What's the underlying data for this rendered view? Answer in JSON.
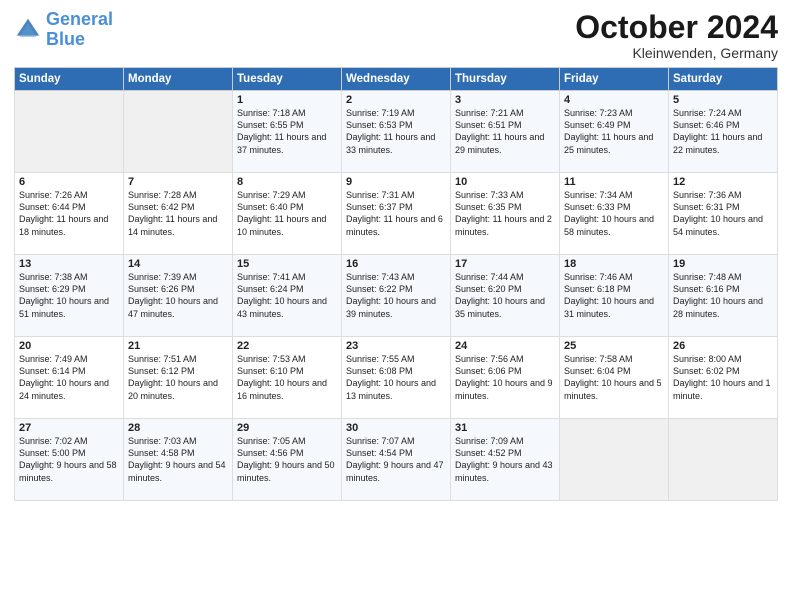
{
  "logo": {
    "line1": "General",
    "line2": "Blue"
  },
  "title": "October 2024",
  "location": "Kleinwenden, Germany",
  "days_header": [
    "Sunday",
    "Monday",
    "Tuesday",
    "Wednesday",
    "Thursday",
    "Friday",
    "Saturday"
  ],
  "weeks": [
    [
      {
        "day": "",
        "info": ""
      },
      {
        "day": "",
        "info": ""
      },
      {
        "day": "1",
        "info": "Sunrise: 7:18 AM\nSunset: 6:55 PM\nDaylight: 11 hours\nand 37 minutes."
      },
      {
        "day": "2",
        "info": "Sunrise: 7:19 AM\nSunset: 6:53 PM\nDaylight: 11 hours\nand 33 minutes."
      },
      {
        "day": "3",
        "info": "Sunrise: 7:21 AM\nSunset: 6:51 PM\nDaylight: 11 hours\nand 29 minutes."
      },
      {
        "day": "4",
        "info": "Sunrise: 7:23 AM\nSunset: 6:49 PM\nDaylight: 11 hours\nand 25 minutes."
      },
      {
        "day": "5",
        "info": "Sunrise: 7:24 AM\nSunset: 6:46 PM\nDaylight: 11 hours\nand 22 minutes."
      }
    ],
    [
      {
        "day": "6",
        "info": "Sunrise: 7:26 AM\nSunset: 6:44 PM\nDaylight: 11 hours\nand 18 minutes."
      },
      {
        "day": "7",
        "info": "Sunrise: 7:28 AM\nSunset: 6:42 PM\nDaylight: 11 hours\nand 14 minutes."
      },
      {
        "day": "8",
        "info": "Sunrise: 7:29 AM\nSunset: 6:40 PM\nDaylight: 11 hours\nand 10 minutes."
      },
      {
        "day": "9",
        "info": "Sunrise: 7:31 AM\nSunset: 6:37 PM\nDaylight: 11 hours\nand 6 minutes."
      },
      {
        "day": "10",
        "info": "Sunrise: 7:33 AM\nSunset: 6:35 PM\nDaylight: 11 hours\nand 2 minutes."
      },
      {
        "day": "11",
        "info": "Sunrise: 7:34 AM\nSunset: 6:33 PM\nDaylight: 10 hours\nand 58 minutes."
      },
      {
        "day": "12",
        "info": "Sunrise: 7:36 AM\nSunset: 6:31 PM\nDaylight: 10 hours\nand 54 minutes."
      }
    ],
    [
      {
        "day": "13",
        "info": "Sunrise: 7:38 AM\nSunset: 6:29 PM\nDaylight: 10 hours\nand 51 minutes."
      },
      {
        "day": "14",
        "info": "Sunrise: 7:39 AM\nSunset: 6:26 PM\nDaylight: 10 hours\nand 47 minutes."
      },
      {
        "day": "15",
        "info": "Sunrise: 7:41 AM\nSunset: 6:24 PM\nDaylight: 10 hours\nand 43 minutes."
      },
      {
        "day": "16",
        "info": "Sunrise: 7:43 AM\nSunset: 6:22 PM\nDaylight: 10 hours\nand 39 minutes."
      },
      {
        "day": "17",
        "info": "Sunrise: 7:44 AM\nSunset: 6:20 PM\nDaylight: 10 hours\nand 35 minutes."
      },
      {
        "day": "18",
        "info": "Sunrise: 7:46 AM\nSunset: 6:18 PM\nDaylight: 10 hours\nand 31 minutes."
      },
      {
        "day": "19",
        "info": "Sunrise: 7:48 AM\nSunset: 6:16 PM\nDaylight: 10 hours\nand 28 minutes."
      }
    ],
    [
      {
        "day": "20",
        "info": "Sunrise: 7:49 AM\nSunset: 6:14 PM\nDaylight: 10 hours\nand 24 minutes."
      },
      {
        "day": "21",
        "info": "Sunrise: 7:51 AM\nSunset: 6:12 PM\nDaylight: 10 hours\nand 20 minutes."
      },
      {
        "day": "22",
        "info": "Sunrise: 7:53 AM\nSunset: 6:10 PM\nDaylight: 10 hours\nand 16 minutes."
      },
      {
        "day": "23",
        "info": "Sunrise: 7:55 AM\nSunset: 6:08 PM\nDaylight: 10 hours\nand 13 minutes."
      },
      {
        "day": "24",
        "info": "Sunrise: 7:56 AM\nSunset: 6:06 PM\nDaylight: 10 hours\nand 9 minutes."
      },
      {
        "day": "25",
        "info": "Sunrise: 7:58 AM\nSunset: 6:04 PM\nDaylight: 10 hours\nand 5 minutes."
      },
      {
        "day": "26",
        "info": "Sunrise: 8:00 AM\nSunset: 6:02 PM\nDaylight: 10 hours\nand 1 minute."
      }
    ],
    [
      {
        "day": "27",
        "info": "Sunrise: 7:02 AM\nSunset: 5:00 PM\nDaylight: 9 hours\nand 58 minutes."
      },
      {
        "day": "28",
        "info": "Sunrise: 7:03 AM\nSunset: 4:58 PM\nDaylight: 9 hours\nand 54 minutes."
      },
      {
        "day": "29",
        "info": "Sunrise: 7:05 AM\nSunset: 4:56 PM\nDaylight: 9 hours\nand 50 minutes."
      },
      {
        "day": "30",
        "info": "Sunrise: 7:07 AM\nSunset: 4:54 PM\nDaylight: 9 hours\nand 47 minutes."
      },
      {
        "day": "31",
        "info": "Sunrise: 7:09 AM\nSunset: 4:52 PM\nDaylight: 9 hours\nand 43 minutes."
      },
      {
        "day": "",
        "info": ""
      },
      {
        "day": "",
        "info": ""
      }
    ]
  ]
}
